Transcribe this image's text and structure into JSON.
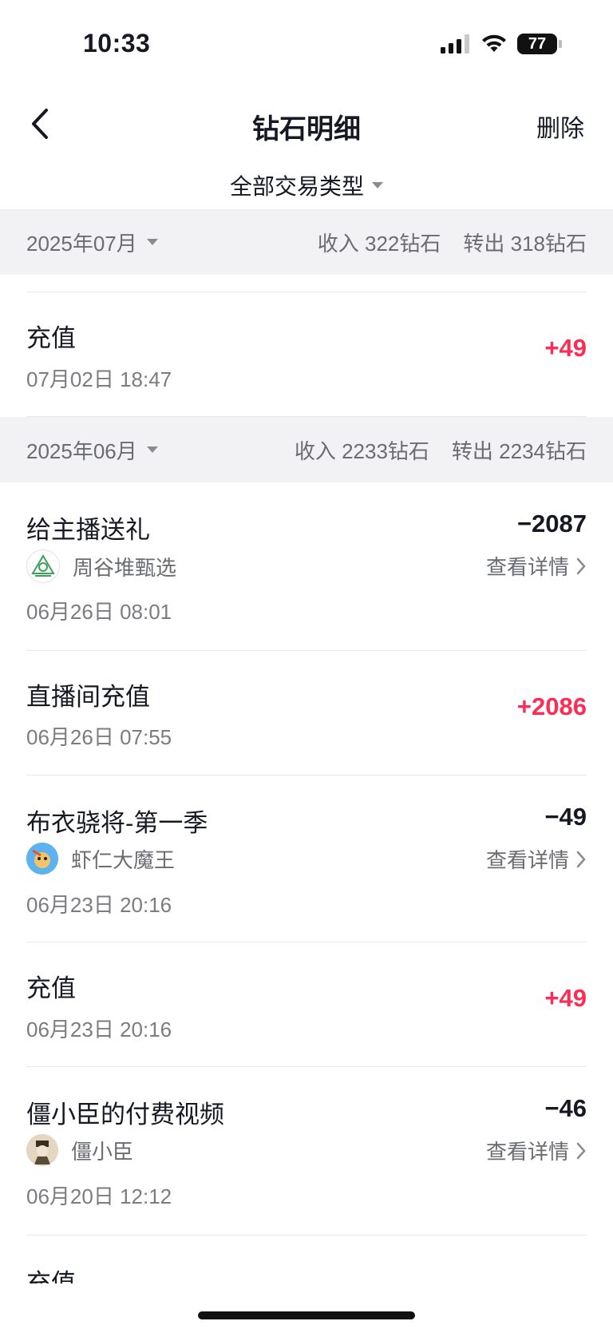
{
  "status": {
    "time": "10:33",
    "battery": "77"
  },
  "nav": {
    "title": "钻石明细",
    "delete_label": "删除"
  },
  "filter": {
    "label": "全部交易类型"
  },
  "months": [
    {
      "label": "2025年07月",
      "income": "收入 322钻石",
      "transfer": "转出 318钻石"
    },
    {
      "label": "2025年06月",
      "income": "收入 2233钻石",
      "transfer": "转出 2234钻石"
    }
  ],
  "items": [
    {
      "title": "充值",
      "date": "07月02日 18:47",
      "amount": "+49"
    },
    {
      "title": "给主播送礼",
      "who": "周谷堆甄选",
      "details": "查看详情",
      "date": "06月26日 08:01",
      "amount": "−2087"
    },
    {
      "title": "直播间充值",
      "date": "06月26日 07:55",
      "amount": "+2086"
    },
    {
      "title": "布衣骁将-第一季",
      "who": "虾仁大魔王",
      "details": "查看详情",
      "date": "06月23日 20:16",
      "amount": "−49"
    },
    {
      "title": "充值",
      "date": "06月23日 20:16",
      "amount": "+49"
    },
    {
      "title": "僵小臣的付费视频",
      "who": "僵小臣",
      "details": "查看详情",
      "date": "06月20日 12:12",
      "amount": "−46"
    },
    {
      "title": "充值"
    }
  ],
  "colors": {
    "positive": "#fe2c55",
    "negative": "#161823",
    "header_bg": "#f2f2f4"
  },
  "icons": [
    "back-chevron-icon",
    "caret-down-icon",
    "chevron-right-icon",
    "signal-icon",
    "wifi-icon",
    "battery-icon"
  ]
}
